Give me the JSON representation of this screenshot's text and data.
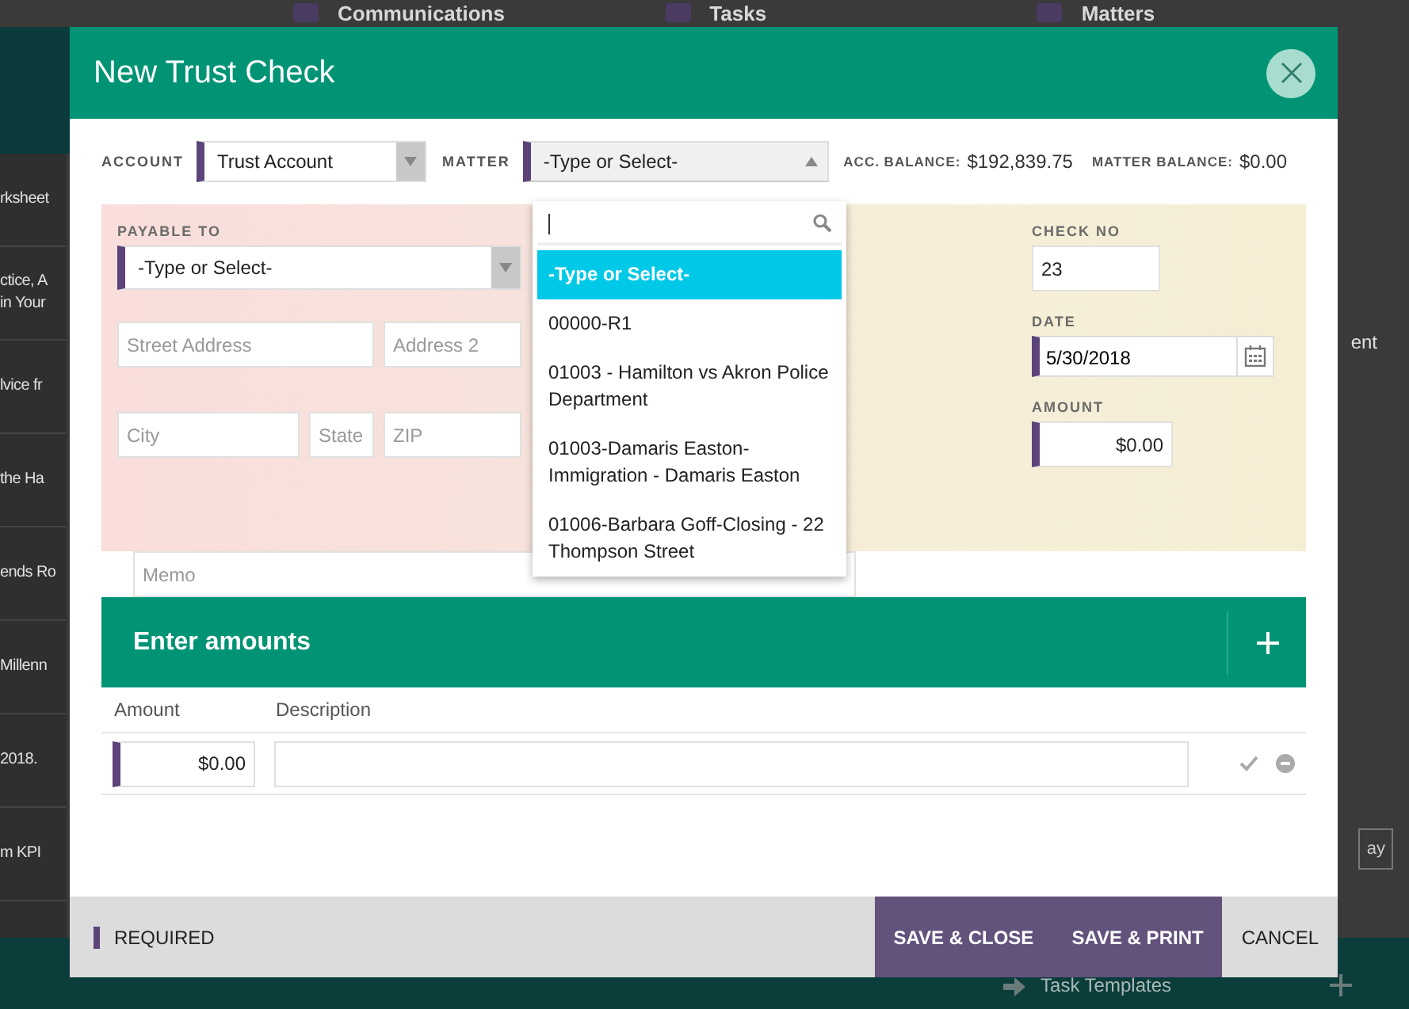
{
  "background_app": {
    "nav": [
      "Communications",
      "Tasks",
      "Matters"
    ],
    "list_fragments": [
      "rksheet",
      "ctice, A\nin Your",
      "lvice fr",
      "the Ha",
      "ends Ro",
      "Millenn",
      "2018.",
      "m KPI"
    ],
    "right_fragment": "ent",
    "right_button": "ay",
    "bottom_link": "Task Templates"
  },
  "dialog": {
    "title": "New Trust Check",
    "account": {
      "label": "ACCOUNT",
      "value": "Trust Account",
      "required": true
    },
    "matter": {
      "label": "MATTER",
      "placeholder": "-Type or Select-",
      "required": true,
      "expanded": true,
      "options": [
        {
          "label": "-Type or Select-",
          "selected": true
        },
        {
          "label": "00000-R1",
          "selected": false
        },
        {
          "label": "01003 - Hamilton vs Akron Police Department",
          "selected": false
        },
        {
          "label": "01003-Damaris Easton-Immigration - Damaris Easton",
          "selected": false
        },
        {
          "label": "01006-Barbara Goff-Closing - 22 Thompson Street",
          "selected": false
        }
      ]
    },
    "balances": [
      {
        "label": "ACC. BALANCE:",
        "value": "$192,839.75"
      },
      {
        "label": "MATTER BALANCE:",
        "value": "$0.00"
      }
    ],
    "payable_to": {
      "label": "PAYABLE TO",
      "placeholder": "-Type or Select-",
      "required": true
    },
    "street": {
      "placeholder": "Street Address"
    },
    "address2": {
      "placeholder": "Address 2"
    },
    "city": {
      "placeholder": "City"
    },
    "state": {
      "placeholder": "State"
    },
    "zip": {
      "placeholder": "ZIP"
    },
    "check_no": {
      "label": "CHECK NO",
      "value": "23",
      "required": false
    },
    "date": {
      "label": "DATE",
      "value": "5/30/2018",
      "required": true
    },
    "amount": {
      "label": "AMOUNT",
      "value": "$0.00",
      "required": true
    },
    "memo": {
      "placeholder": "Memo"
    },
    "amounts": {
      "title": "Enter amounts",
      "columns": [
        "Amount",
        "Description"
      ],
      "rows": [
        {
          "amount": "$0.00",
          "required": true
        }
      ]
    },
    "footer": {
      "legend": "REQUIRED",
      "buttons": [
        {
          "label": "SAVE & CLOSE",
          "kind": "primary"
        },
        {
          "label": "SAVE & PRINT",
          "kind": "primary"
        },
        {
          "label": "CANCEL",
          "kind": "plain"
        }
      ]
    }
  }
}
